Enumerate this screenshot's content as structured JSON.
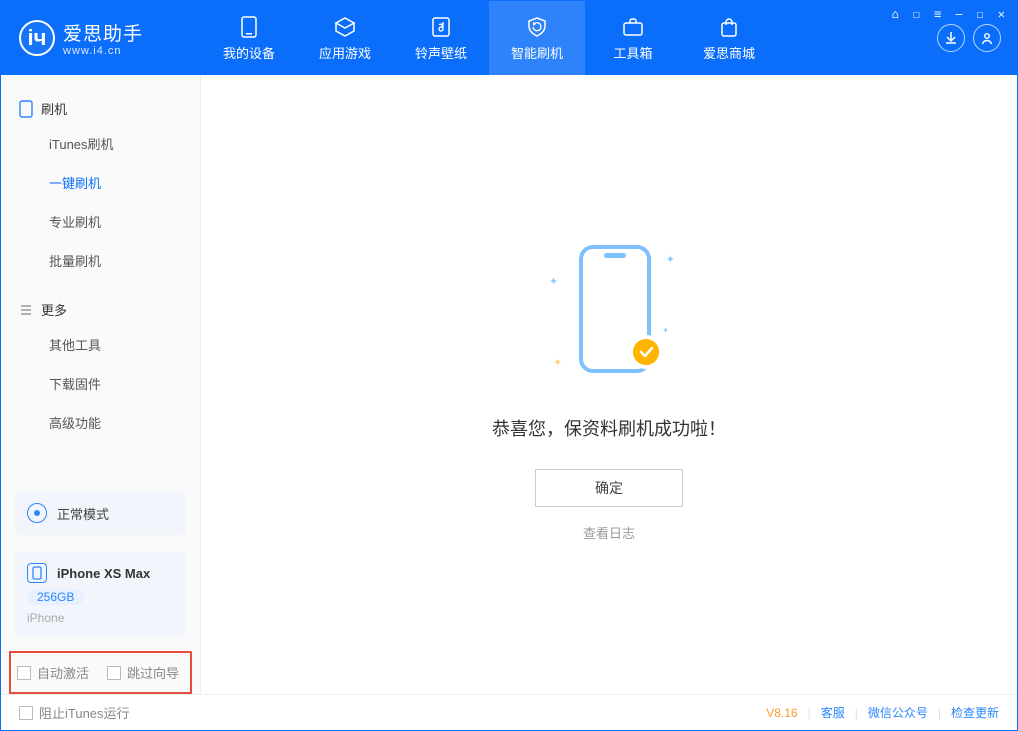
{
  "app": {
    "name": "爱思助手",
    "subdomain": "www.i4.cn"
  },
  "windowControls": [
    "⎋",
    "☐",
    "≡",
    "—",
    "☐",
    "✕"
  ],
  "headerTabs": [
    {
      "label": "我的设备",
      "icon": "phone-icon"
    },
    {
      "label": "应用游戏",
      "icon": "cube-icon"
    },
    {
      "label": "铃声壁纸",
      "icon": "music-icon"
    },
    {
      "label": "智能刷机",
      "icon": "refresh-shield-icon",
      "selected": true
    },
    {
      "label": "工具箱",
      "icon": "briefcase-icon"
    },
    {
      "label": "爱思商城",
      "icon": "bag-icon"
    }
  ],
  "sidebar": {
    "section1": {
      "title": "刷机",
      "items": [
        {
          "label": "iTunes刷机"
        },
        {
          "label": "一键刷机",
          "active": true
        },
        {
          "label": "专业刷机"
        },
        {
          "label": "批量刷机"
        }
      ]
    },
    "section2": {
      "title": "更多",
      "items": [
        {
          "label": "其他工具"
        },
        {
          "label": "下载固件"
        },
        {
          "label": "高级功能"
        }
      ]
    }
  },
  "modeBox": {
    "label": "正常模式"
  },
  "deviceBox": {
    "name": "iPhone XS Max",
    "capacity": "256GB",
    "sub": "iPhone"
  },
  "highlightOptions": {
    "auto_activate": "自动激活",
    "skip_guide": "跳过向导"
  },
  "main": {
    "success_msg": "恭喜您，保资料刷机成功啦！",
    "ok_label": "确定",
    "log_link": "查看日志"
  },
  "footer": {
    "block_itunes": "阻止iTunes运行",
    "version": "V8.16",
    "links": [
      "客服",
      "微信公众号",
      "检查更新"
    ]
  }
}
